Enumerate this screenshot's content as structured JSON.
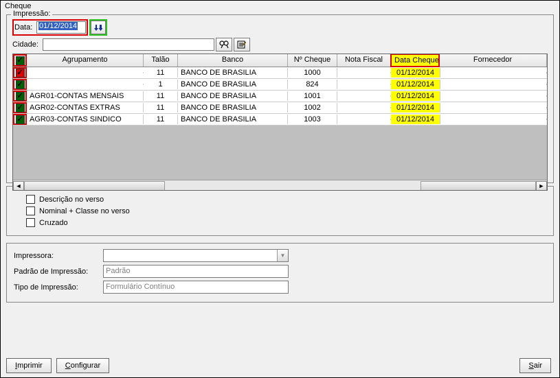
{
  "window": {
    "title": "Cheque"
  },
  "impressao": {
    "legend": "Impressão:",
    "data_label": "Data:",
    "data_value": "01/12/2014",
    "arrows_label": "↓↓",
    "cidade_label": "Cidade:",
    "cidade_value": ""
  },
  "grid": {
    "headers": {
      "agrupamento": "Agrupamento",
      "talao": "Talão",
      "banco": "Banco",
      "ncheque": "Nº Cheque",
      "nota_fiscal": "Nota Fiscal",
      "data_cheque": "Data Cheque",
      "fornecedor": "Fornecedor"
    },
    "rows": [
      {
        "checked": true,
        "chk_color": "red",
        "agrupamento": "",
        "talao": "11",
        "banco": "BANCO DE BRASILIA",
        "ncheque": "1000",
        "nf": "",
        "data_cheque": "01/12/2014",
        "fornecedor": ""
      },
      {
        "checked": true,
        "chk_color": "green",
        "agrupamento": "",
        "talao": "1",
        "banco": "BANCO DE BRASILIA",
        "ncheque": "824",
        "nf": "",
        "data_cheque": "01/12/2014",
        "fornecedor": ""
      },
      {
        "checked": true,
        "chk_color": "green",
        "agrupamento": "AGR01-CONTAS MENSAIS",
        "talao": "11",
        "banco": "BANCO DE BRASILIA",
        "ncheque": "1001",
        "nf": "",
        "data_cheque": "01/12/2014",
        "fornecedor": ""
      },
      {
        "checked": true,
        "chk_color": "green",
        "agrupamento": "AGR02-CONTAS EXTRAS",
        "talao": "11",
        "banco": "BANCO DE BRASILIA",
        "ncheque": "1002",
        "nf": "",
        "data_cheque": "01/12/2014",
        "fornecedor": ""
      },
      {
        "checked": true,
        "chk_color": "green",
        "agrupamento": "AGR03-CONTAS SINDICO",
        "talao": "11",
        "banco": "BANCO DE BRASILIA",
        "ncheque": "1003",
        "nf": "",
        "data_cheque": "01/12/2014",
        "fornecedor": ""
      }
    ]
  },
  "options": {
    "descricao_verso": "Descrição no verso",
    "nominal_classe": "Nominal + Classe no verso",
    "cruzado": "Cruzado"
  },
  "printer": {
    "impressora_label": "Impressora:",
    "impressora_value": "",
    "padrao_label": "Padrão de Impressão:",
    "padrao_value": "Padrão",
    "tipo_label": "Tipo de Impressão:",
    "tipo_value": "Formulário Contínuo"
  },
  "buttons": {
    "imprimir": "Imprimir",
    "configurar": "Configurar",
    "sair": "Sair"
  }
}
